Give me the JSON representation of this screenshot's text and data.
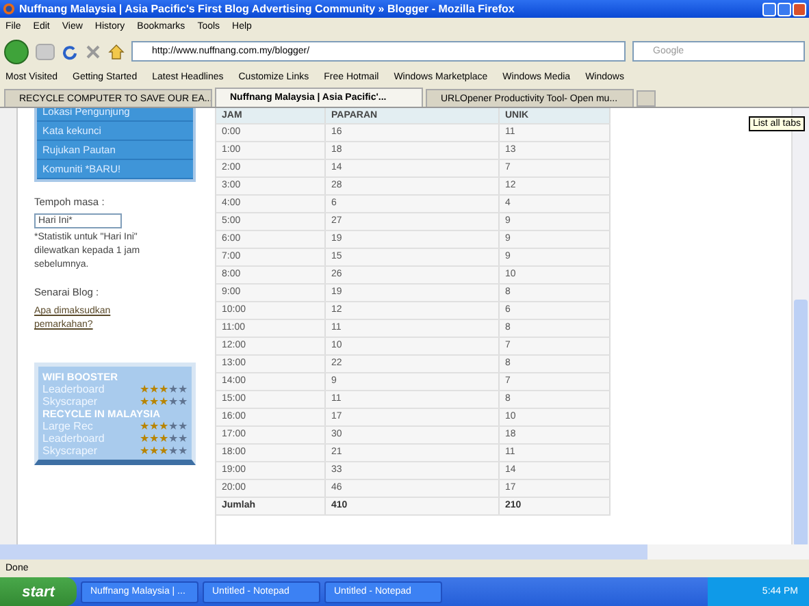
{
  "window": {
    "title": "Nuffnang Malaysia | Asia Pacific's First Blog Advertising Community » Blogger - Mozilla Firefox"
  },
  "menu": [
    "File",
    "Edit",
    "View",
    "History",
    "Bookmarks",
    "Tools",
    "Help"
  ],
  "address": {
    "value": "http://www.nuffnang.com.my/blogger/"
  },
  "search": {
    "placeholder": "Google"
  },
  "bookmarks": [
    "Most Visited",
    "Getting Started",
    "Latest Headlines",
    "Customize Links",
    "Free Hotmail",
    "Windows Marketplace",
    "Windows Media",
    "Windows"
  ],
  "tabs": [
    {
      "label": "RECYCLE COMPUTER TO SAVE OUR EA...",
      "selected": false
    },
    {
      "label": "Nuffnang Malaysia | Asia Pacific'...",
      "selected": true
    },
    {
      "label": "URLOpener Productivity Tool- Open mu...",
      "selected": false
    }
  ],
  "tooltip": "List all tabs",
  "sidebar": {
    "items": [
      "Lokasi Pengunjung",
      "Kata kekunci",
      "Rujukan Pautan",
      "Komuniti *BARU!"
    ],
    "period_label": "Tempoh masa :",
    "period_value": "Hari Ini*",
    "note": "*Statistik untuk \"Hari Ini\" dilewatkan kepada 1 jam sebelumnya.",
    "blog_label": "Senarai Blog :",
    "link": "Apa dimaksudkan pemarkahan?",
    "ads": [
      {
        "title": "WIFI BOOSTER",
        "rows": [
          {
            "label": "Leaderboard",
            "stars": 3
          },
          {
            "label": "Skyscraper",
            "stars": 3
          }
        ]
      },
      {
        "title": "RECYCLE IN MALAYSIA",
        "rows": [
          {
            "label": "Large Rec",
            "stars": 3
          },
          {
            "label": "Leaderboard",
            "stars": 3
          },
          {
            "label": "Skyscraper",
            "stars": 3
          }
        ]
      }
    ]
  },
  "table": {
    "columns": [
      "JAM",
      "PAPARAN",
      "UNIK"
    ],
    "rows": [
      [
        "0:00",
        "16",
        "11"
      ],
      [
        "1:00",
        "18",
        "13"
      ],
      [
        "2:00",
        "14",
        "7"
      ],
      [
        "3:00",
        "28",
        "12"
      ],
      [
        "4:00",
        "6",
        "4"
      ],
      [
        "5:00",
        "27",
        "9"
      ],
      [
        "6:00",
        "19",
        "9"
      ],
      [
        "7:00",
        "15",
        "9"
      ],
      [
        "8:00",
        "26",
        "10"
      ],
      [
        "9:00",
        "19",
        "8"
      ],
      [
        "10:00",
        "12",
        "6"
      ],
      [
        "11:00",
        "11",
        "8"
      ],
      [
        "12:00",
        "10",
        "7"
      ],
      [
        "13:00",
        "22",
        "8"
      ],
      [
        "14:00",
        "9",
        "7"
      ],
      [
        "15:00",
        "11",
        "8"
      ],
      [
        "16:00",
        "17",
        "10"
      ],
      [
        "17:00",
        "30",
        "18"
      ],
      [
        "18:00",
        "21",
        "11"
      ],
      [
        "19:00",
        "33",
        "14"
      ],
      [
        "20:00",
        "46",
        "17"
      ]
    ],
    "total": [
      "Jumlah",
      "410",
      "210"
    ]
  },
  "status_bar": "Done",
  "taskbar": {
    "start": "start",
    "tasks": [
      "Nuffnang Malaysia | ...",
      "Untitled - Notepad",
      "Untitled - Notepad"
    ],
    "clock": "5:44 PM"
  }
}
